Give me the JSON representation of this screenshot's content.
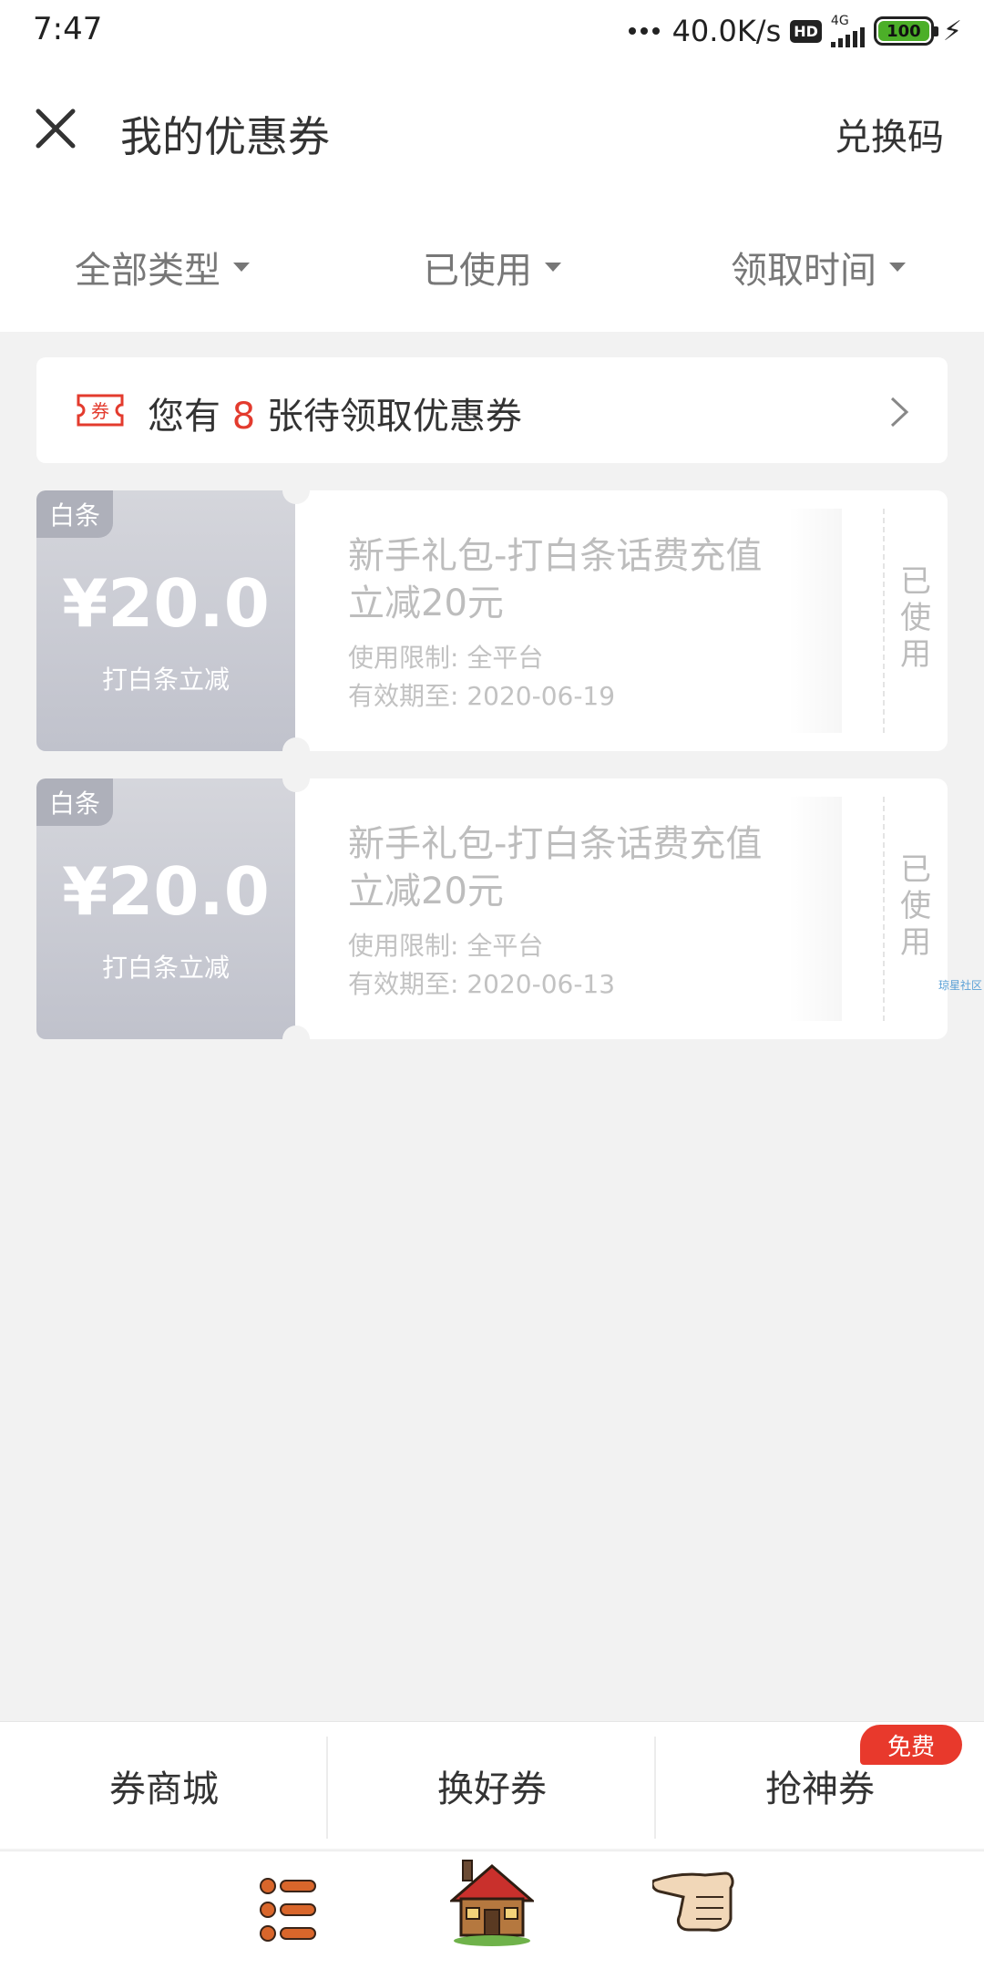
{
  "status_bar": {
    "time": "7:47",
    "net_speed": "40.0K/s",
    "hd_label": "HD",
    "network_type": "4G",
    "battery": "100"
  },
  "header": {
    "title": "我的优惠券",
    "redeem_label": "兑换码"
  },
  "filters": [
    {
      "label": "全部类型"
    },
    {
      "label": "已使用"
    },
    {
      "label": "领取时间"
    }
  ],
  "banner": {
    "icon_text": "券",
    "prefix": "您有",
    "count": "8",
    "suffix": "张待领取优惠券"
  },
  "coupons": [
    {
      "tag": "白条",
      "amount": "¥20.0",
      "subtitle": "打白条立减",
      "title": "新手礼包-打白条话费充值立减20元",
      "limit": "使用限制: 全平台",
      "valid": "有效期至: 2020-06-19",
      "status": "已使用"
    },
    {
      "tag": "白条",
      "amount": "¥20.0",
      "subtitle": "打白条立减",
      "title": "新手礼包-打白条话费充值立减20元",
      "limit": "使用限制: 全平台",
      "valid": "有效期至: 2020-06-13",
      "status": "已使用"
    }
  ],
  "watermark": "琼星社区",
  "bottom_tabs": [
    {
      "label": "券商城"
    },
    {
      "label": "换好券"
    },
    {
      "label": "抢神券"
    }
  ],
  "badge": "免费",
  "accent_color": "#e33b2e",
  "icons": [
    "close-icon",
    "caret-down-icon",
    "ticket-icon",
    "chevron-right-icon",
    "list-menu-icon",
    "house-icon",
    "pointing-hand-icon"
  ]
}
